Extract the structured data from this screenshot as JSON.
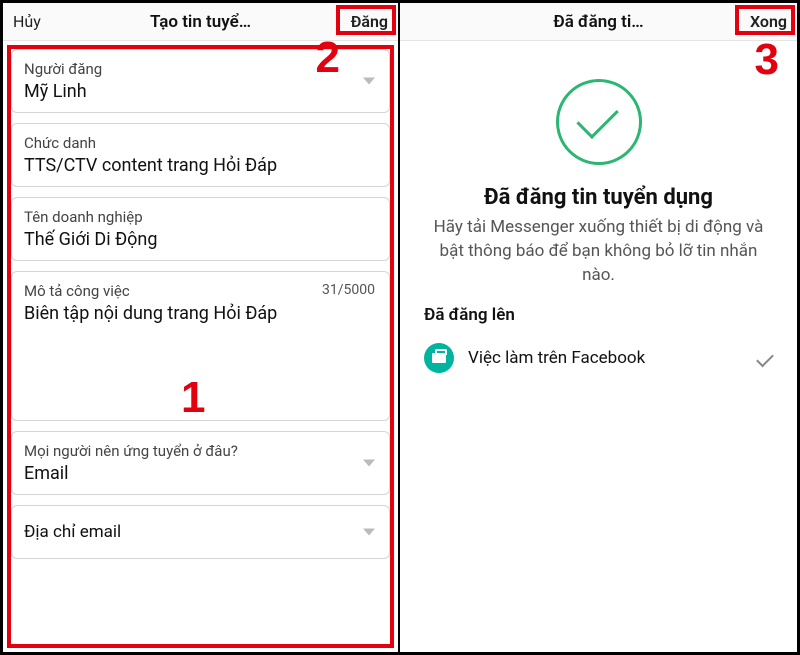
{
  "left": {
    "header": {
      "cancel": "Hủy",
      "title": "Tạo tin tuyể…",
      "submit": "Đăng"
    },
    "fields": {
      "poster_label": "Người đăng",
      "poster_value": "Mỹ Linh",
      "title_label": "Chức danh",
      "title_value": "TTS/CTV content trang Hỏi Đáp",
      "company_label": "Tên doanh nghiệp",
      "company_value": "Thế Giới Di Động",
      "desc_label": "Mô tả công việc",
      "desc_value": "Biên tập nội dung trang Hỏi Đáp",
      "desc_count": "31/5000",
      "apply_label": "Mọi người nên ứng tuyển ở đâu?",
      "apply_value": "Email",
      "email_label": "Địa chỉ email"
    }
  },
  "right": {
    "header": {
      "title": "Đã đăng ti…",
      "done": "Xong"
    },
    "success_title": "Đã đăng tin tuyển dụng",
    "success_subtitle": "Hãy tải Messenger xuống thiết bị di động và bật thông báo để bạn không bỏ lỡ tin nhắn nào.",
    "posted_label": "Đã đăng lên",
    "posted_item": "Việc làm trên Facebook"
  },
  "annotations": {
    "n1": "1",
    "n2": "2",
    "n3": "3"
  }
}
